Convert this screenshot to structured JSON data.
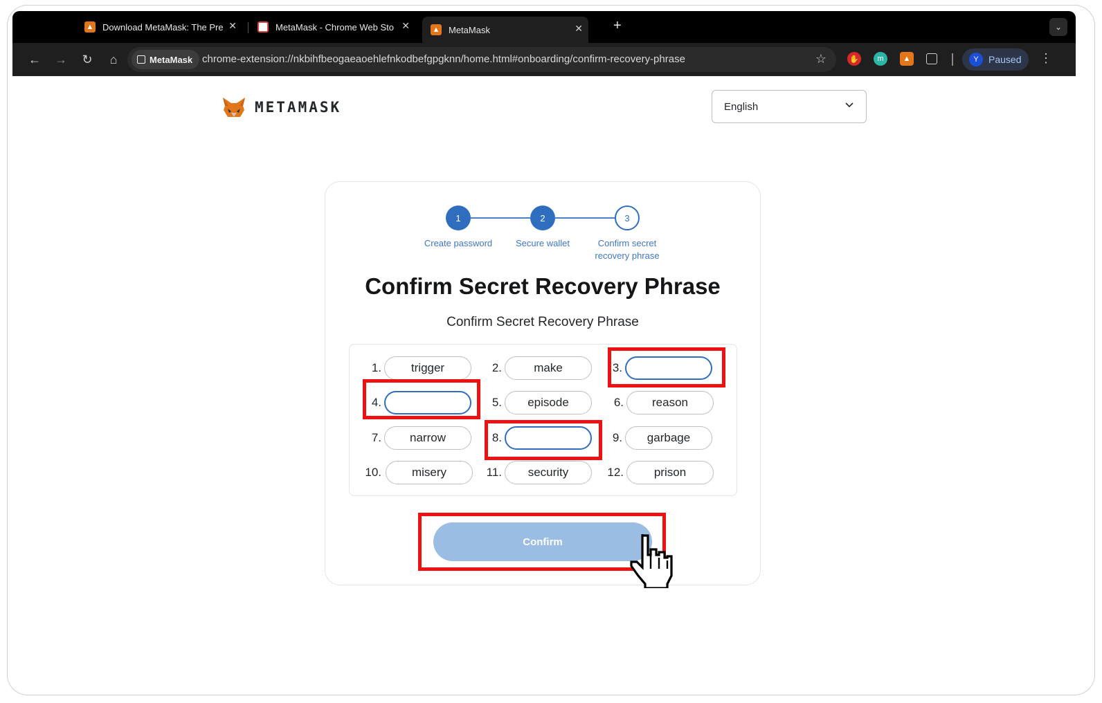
{
  "browser": {
    "tabs": [
      {
        "title": "Download MetaMask: The Pre",
        "icon": "fox-icon",
        "active": false
      },
      {
        "title": "MetaMask - Chrome Web Sto",
        "icon": "webstore-icon",
        "active": false
      },
      {
        "title": "MetaMask",
        "icon": "fox-icon",
        "active": true
      }
    ],
    "new_tab": "+",
    "site_chip": "MetaMask",
    "url": "chrome-extension://nkbihfbeogaeaoehlefnkodbefgpgknn/home.html#onboarding/confirm-recovery-phrase",
    "profile_initial": "Y",
    "profile_status": "Paused"
  },
  "header": {
    "logo_text": "METAMASK",
    "language": "English"
  },
  "stepper": {
    "steps": [
      {
        "number": "1",
        "label": "Create password",
        "state": "complete"
      },
      {
        "number": "2",
        "label": "Secure wallet",
        "state": "complete"
      },
      {
        "number": "3",
        "label": "Confirm secret recovery phrase",
        "state": "current"
      }
    ]
  },
  "main": {
    "title": "Confirm Secret Recovery Phrase",
    "subtitle": "Confirm Secret Recovery Phrase",
    "words": [
      {
        "index": "1.",
        "word": "trigger",
        "blank": false
      },
      {
        "index": "2.",
        "word": "make",
        "blank": false
      },
      {
        "index": "3.",
        "word": "",
        "blank": true
      },
      {
        "index": "4.",
        "word": "",
        "blank": true
      },
      {
        "index": "5.",
        "word": "episode",
        "blank": false
      },
      {
        "index": "6.",
        "word": "reason",
        "blank": false
      },
      {
        "index": "7.",
        "word": "narrow",
        "blank": false
      },
      {
        "index": "8.",
        "word": "",
        "blank": true
      },
      {
        "index": "9.",
        "word": "garbage",
        "blank": false
      },
      {
        "index": "10.",
        "word": "misery",
        "blank": false
      },
      {
        "index": "11.",
        "word": "security",
        "blank": false
      },
      {
        "index": "12.",
        "word": "prison",
        "blank": false
      }
    ],
    "confirm_label": "Confirm"
  },
  "colors": {
    "accent": "#2f6ebf",
    "confirm_disabled": "#9bbde3",
    "highlight": "#ee1111"
  }
}
